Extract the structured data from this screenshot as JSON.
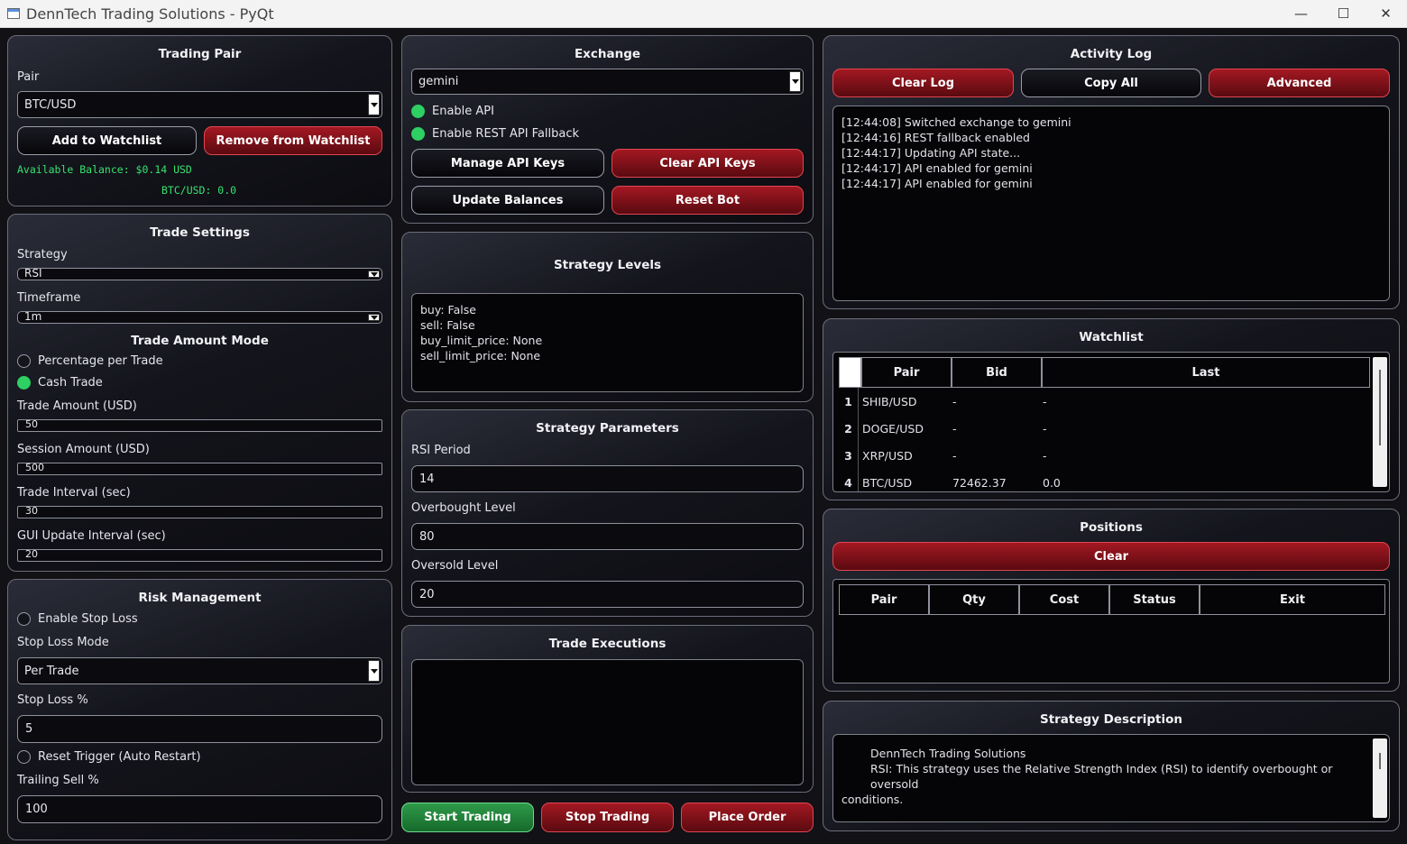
{
  "window": {
    "title": "DennTech Trading Solutions - PyQt"
  },
  "trading_pair": {
    "title": "Trading Pair",
    "pair_label": "Pair",
    "pair_value": "BTC/USD",
    "add_label": "Add to Watchlist",
    "remove_label": "Remove from Watchlist",
    "balance_text": "Available Balance: $0.14 USD",
    "price_text": "BTC/USD: 0.0"
  },
  "trade_settings": {
    "title": "Trade Settings",
    "strategy_label": "Strategy",
    "strategy_value": "RSI",
    "timeframe_label": "Timeframe",
    "timeframe_value": "1m",
    "amount_mode_title": "Trade Amount Mode",
    "percentage_label": "Percentage per Trade",
    "percentage_selected": false,
    "cash_label": "Cash Trade",
    "cash_selected": true,
    "trade_amount_label": "Trade Amount (USD)",
    "trade_amount_value": "50",
    "session_amount_label": "Session Amount (USD)",
    "session_amount_value": "500",
    "trade_interval_label": "Trade Interval (sec)",
    "trade_interval_value": "30",
    "gui_interval_label": "GUI Update Interval (sec)",
    "gui_interval_value": "20"
  },
  "risk": {
    "title": "Risk Management",
    "enable_stop_loss_label": "Enable Stop Loss",
    "stop_loss_enabled": false,
    "stop_loss_mode_label": "Stop Loss Mode",
    "stop_loss_mode_value": "Per Trade",
    "stop_loss_pct_label": "Stop Loss %",
    "stop_loss_pct_value": "5",
    "reset_trigger_label": "Reset Trigger (Auto Restart)",
    "reset_trigger_enabled": false,
    "trailing_sell_label": "Trailing Sell %",
    "trailing_sell_value": "100"
  },
  "exchange": {
    "title": "Exchange",
    "value": "gemini",
    "enable_api_label": "Enable API",
    "api_enabled": true,
    "rest_fallback_label": "Enable REST API Fallback",
    "rest_fallback_enabled": true,
    "manage_keys_label": "Manage API Keys",
    "clear_keys_label": "Clear API Keys",
    "update_balances_label": "Update Balances",
    "reset_bot_label": "Reset Bot"
  },
  "strategy_levels": {
    "title": "Strategy Levels",
    "lines": [
      "buy: False",
      "sell: False",
      "buy_limit_price: None",
      "sell_limit_price: None"
    ]
  },
  "strategy_params": {
    "title": "Strategy Parameters",
    "rsi_period_label": "RSI Period",
    "rsi_period_value": "14",
    "overbought_label": "Overbought Level",
    "overbought_value": "80",
    "oversold_label": "Oversold Level",
    "oversold_value": "20"
  },
  "trade_executions": {
    "title": "Trade Executions"
  },
  "controls": {
    "start_label": "Start Trading",
    "stop_label": "Stop Trading",
    "place_order_label": "Place Order"
  },
  "activity_log": {
    "title": "Activity Log",
    "clear_label": "Clear Log",
    "copy_label": "Copy All",
    "advanced_label": "Advanced",
    "lines": [
      "[12:44:08] Switched exchange to gemini",
      "[12:44:16] REST fallback enabled",
      "[12:44:17] Updating API state...",
      "[12:44:17] API enabled for gemini",
      "[12:44:17] API enabled for gemini"
    ]
  },
  "watchlist": {
    "title": "Watchlist",
    "columns": [
      "Pair",
      "Bid",
      "Last"
    ],
    "rows": [
      {
        "num": "1",
        "pair": "SHIB/USD",
        "bid": "-",
        "last": "-"
      },
      {
        "num": "2",
        "pair": "DOGE/USD",
        "bid": "-",
        "last": "-"
      },
      {
        "num": "3",
        "pair": "XRP/USD",
        "bid": "-",
        "last": "-"
      },
      {
        "num": "4",
        "pair": "BTC/USD",
        "bid": "72462.37",
        "last": "0.0"
      }
    ]
  },
  "positions": {
    "title": "Positions",
    "clear_label": "Clear",
    "columns": [
      "Pair",
      "Qty",
      "Cost",
      "Status",
      "Exit"
    ]
  },
  "strategy_description": {
    "title": "Strategy Description",
    "line1": "DennTech Trading Solutions",
    "line2": "RSI: This strategy uses the Relative Strength Index (RSI) to identify overbought or oversold",
    "line3": "conditions."
  }
}
